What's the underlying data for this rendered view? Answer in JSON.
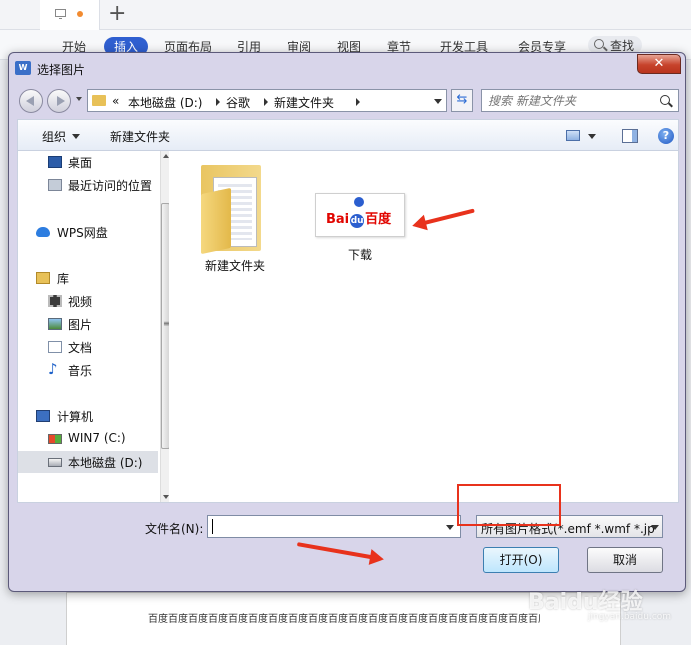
{
  "app": {
    "menu": [
      "开始",
      "插入",
      "页面布局",
      "引用",
      "审阅",
      "视图",
      "章节",
      "开发工具",
      "会员专享"
    ],
    "active_menu": "插入",
    "search_label": "查找",
    "doc_text": "百度百度百度百度百度百度百度百度百度百度百度百度百度百度百度百度百度百度百度百度百度百度百度百度百度百度百度百度百度百度百度百度百度百度百度百度百度百度"
  },
  "dialog": {
    "title": "选择图片",
    "close_label": "✕",
    "breadcrumb": {
      "overflow": "«",
      "items": [
        "本地磁盘 (D:)",
        "谷歌",
        "新建文件夹"
      ]
    },
    "search_placeholder": "搜索 新建文件夹",
    "toolbar": {
      "organize_label": "组织",
      "new_folder_label": "新建文件夹",
      "help_label": "?"
    },
    "nav": {
      "desktop": "桌面",
      "recent": "最近访问的位置",
      "wps_cloud": "WPS网盘",
      "library": "库",
      "videos": "视频",
      "pictures": "图片",
      "documents": "文档",
      "music": "音乐",
      "computer": "计算机",
      "drive_c": "WIN7 (C:)",
      "drive_d": "本地磁盘 (D:)"
    },
    "files": [
      {
        "name": "新建文件夹",
        "type": "folder"
      },
      {
        "name": "下载",
        "type": "image"
      }
    ],
    "thumb_logo": {
      "bai": "Bai",
      "du": "du",
      "baidu_cn": "百度"
    },
    "filename_label": "文件名(N):",
    "filename_value": "",
    "filetype_value": "所有图片格式(*.emf *.wmf *.jp",
    "open_label": "打开(O)",
    "cancel_label": "取消"
  },
  "watermark": {
    "main": "Baidu经验",
    "sub": "jingyan.baidu.com"
  },
  "colors": {
    "accent": "#2f5fd0",
    "annotation": "#e8321c",
    "dialog_frame": "#d8d5ea"
  }
}
